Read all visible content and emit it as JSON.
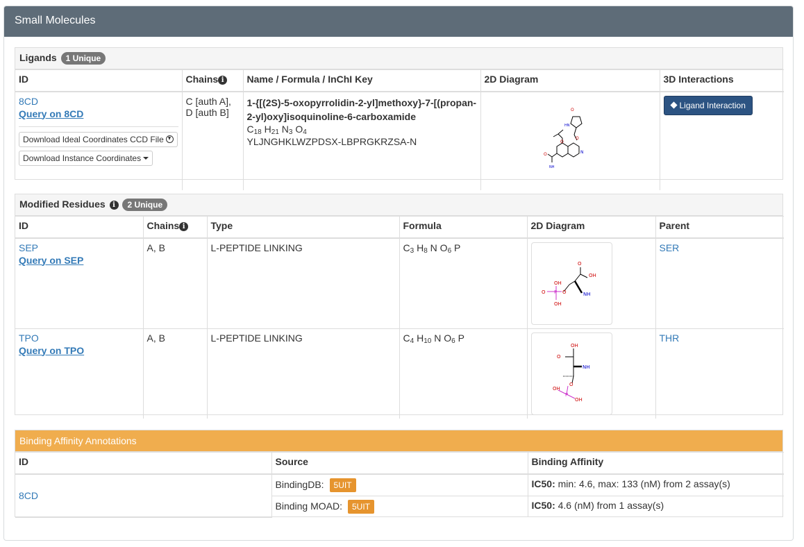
{
  "section_title": "Small Molecules",
  "ligands": {
    "title": "Ligands",
    "badge": "1 Unique",
    "headers": [
      "ID",
      "Chains",
      "Name / Formula / InChI Key",
      "2D Diagram",
      "3D Interactions"
    ],
    "row": {
      "id": "8CD",
      "query": "Query on 8CD",
      "download_ideal": "Download Ideal Coordinates CCD File",
      "download_instance": "Download Instance Coordinates",
      "chains_line1": "C [auth A],",
      "chains_line2": "D [auth B]",
      "name": "1-{[(2S)-5-oxopyrrolidin-2-yl]methoxy}-7-[(propan-2-yl)oxy]isoquinoline-6-carboxamide",
      "formula_parts": [
        "C",
        "18",
        "H",
        "21",
        "N",
        "3",
        "O",
        "4"
      ],
      "inchi_key": "YLJNGHKLWZPDSX-LBPRGKRZSA-N",
      "interaction_button": "Ligand Interaction"
    }
  },
  "modified_residues": {
    "title": "Modified Residues",
    "badge": "2 Unique",
    "headers": [
      "ID",
      "Chains",
      "Type",
      "Formula",
      "2D Diagram",
      "Parent"
    ],
    "rows": [
      {
        "id": "SEP",
        "query": "Query on SEP",
        "chains": "A, B",
        "type": "L-PEPTIDE LINKING",
        "formula_parts": [
          "C",
          "3",
          "H",
          "8",
          "N",
          "",
          "O",
          "6",
          "P",
          ""
        ],
        "parent": "SER"
      },
      {
        "id": "TPO",
        "query": "Query on TPO",
        "chains": "A, B",
        "type": "L-PEPTIDE LINKING",
        "formula_parts": [
          "C",
          "4",
          "H",
          "10",
          "N",
          "",
          "O",
          "6",
          "P",
          ""
        ],
        "parent": "THR"
      }
    ]
  },
  "binding": {
    "title": "Binding Affinity Annotations",
    "headers": [
      "ID",
      "Source",
      "Binding Affinity"
    ],
    "id": "8CD",
    "rows": [
      {
        "source": "BindingDB:",
        "tag": "5UIT",
        "label": "IC50:",
        "value": " min: 4.6, max: 133 (nM) from 2 assay(s)"
      },
      {
        "source": "Binding MOAD:",
        "tag": "5UIT",
        "label": "IC50:",
        "value": " 4.6 (nM) from 1 assay(s)"
      }
    ]
  },
  "diagram_labels": {
    "o": "O",
    "hn": "HN",
    "n": "N",
    "nh2": "NH",
    "oh": "OH",
    "p": "P",
    "h": "H"
  },
  "colors": {
    "header_bar": "#5e6c78",
    "link": "#337ab7",
    "primary_button": "#2c5382",
    "orange": "#f0ad4e",
    "tag": "#e6942e"
  }
}
